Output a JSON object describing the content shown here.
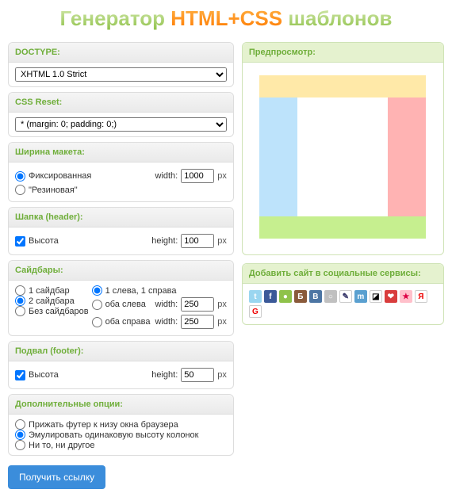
{
  "title": {
    "part1": "Генератор ",
    "part2": "HTML+CSS",
    "part3": " шаблонов"
  },
  "sections": {
    "doctype": {
      "label": "DOCTYPE:",
      "value": "XHTML 1.0 Strict"
    },
    "reset": {
      "label": "CSS Reset:",
      "value": "* (margin: 0; padding: 0;)"
    },
    "width": {
      "label": "Ширина макета:",
      "fixed": "Фиксированная",
      "fluid": "\"Резиновая\"",
      "widthLabel": "width:",
      "widthValue": "1000",
      "widthUnit": "px"
    },
    "header": {
      "label": "Шапка (header):",
      "heightCheck": "Высота",
      "heightLabel": "height:",
      "heightValue": "100",
      "heightUnit": "px"
    },
    "sidebars": {
      "label": "Сайдбары:",
      "count1": "1 сайдбар",
      "count2": "2 сайдбара",
      "count0": "Без сайдбаров",
      "pos1": "1 слева, 1 справа",
      "pos2": "оба слева",
      "pos3": "оба справа",
      "widthLabel": "width:",
      "w1": "250",
      "u1": "px",
      "w2": "250",
      "u2": "px"
    },
    "footer": {
      "label": "Подвал (footer):",
      "heightCheck": "Высота",
      "heightLabel": "height:",
      "heightValue": "50",
      "heightUnit": "px"
    },
    "extra": {
      "label": "Дополнительные опции:",
      "opt1": "Прижать футер к низу окна браузера",
      "opt2": "Эмулировать одинаковую высоту колонок",
      "opt3": "Ни то, ни другое"
    }
  },
  "button": "Получить ссылку",
  "preview": {
    "label": "Предпросмотр:",
    "colors": {
      "header": "#ffe9a8",
      "sidebarLeft": "#bde3fb",
      "content": "#ffffff",
      "sidebarRight": "#ffb3b3",
      "footer": "#c6ef8f"
    }
  },
  "social": {
    "label": "Добавить сайт в социальные сервисы:",
    "icons": [
      {
        "name": "twitter-icon",
        "bg": "#9ad6f0",
        "txt": "t"
      },
      {
        "name": "facebook-icon",
        "bg": "#3b5998",
        "txt": "f"
      },
      {
        "name": "buzz-icon",
        "bg": "#8fc24a",
        "txt": "●"
      },
      {
        "name": "bobrdobr-icon",
        "bg": "#8a5a3b",
        "txt": "Б"
      },
      {
        "name": "vk-icon",
        "bg": "#4c75a3",
        "txt": "B"
      },
      {
        "name": "moikrug-icon",
        "bg": "#c0c0c0",
        "txt": "○"
      },
      {
        "name": "livejournal-icon",
        "bg": "#ffffff",
        "txt": "✎",
        "fg": "#336"
      },
      {
        "name": "memori-icon",
        "bg": "#5aa0d0",
        "txt": "m"
      },
      {
        "name": "delicious-icon",
        "bg": "#ffffff",
        "txt": "◪",
        "fg": "#000"
      },
      {
        "name": "mister-wong-icon",
        "bg": "#d93d3d",
        "txt": "❤"
      },
      {
        "name": "bookmark-icon",
        "bg": "#ffc0cb",
        "txt": "★",
        "fg": "#d04"
      },
      {
        "name": "yandex-icon",
        "bg": "#ffffff",
        "txt": "Я",
        "fg": "#e00"
      },
      {
        "name": "google-icon",
        "bg": "#ffffff",
        "txt": "G",
        "fg": "#e00"
      }
    ]
  }
}
